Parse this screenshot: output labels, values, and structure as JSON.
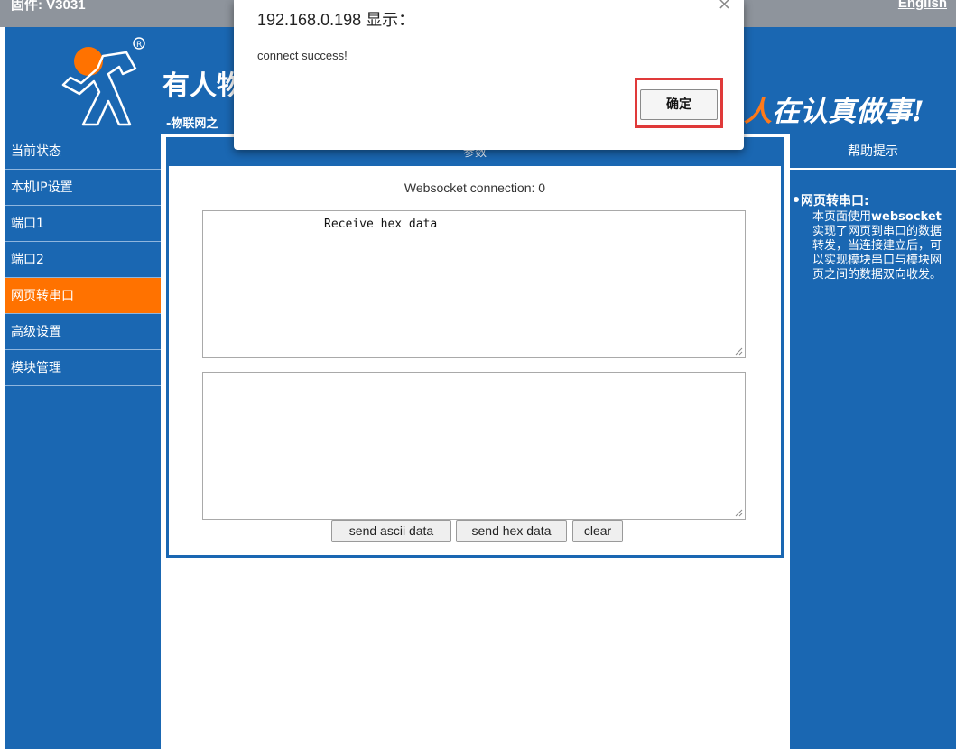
{
  "topbar": {
    "firmware": "固件: V3031",
    "language_link": "English"
  },
  "banner": {
    "company_name": "有人物",
    "company_sub": "-物联网之",
    "slogan_accent": "人",
    "slogan_rest": "在认真做事!"
  },
  "sidebar": {
    "items": [
      {
        "label": "当前状态"
      },
      {
        "label": "本机IP设置"
      },
      {
        "label": "端口1"
      },
      {
        "label": "端口2"
      },
      {
        "label": "网页转串口"
      },
      {
        "label": "高级设置"
      },
      {
        "label": "模块管理"
      }
    ],
    "active_index": 4
  },
  "main": {
    "header": "参数",
    "ws_status": "Websocket connection: 0",
    "receive_text": "Receive hex data",
    "send_text": "",
    "buttons": {
      "send_ascii": "send ascii data",
      "send_hex": "send hex data",
      "clear": "clear"
    }
  },
  "help": {
    "header": "帮助提示",
    "title": "网页转串口:",
    "text_before": "本页面使用",
    "text_bold": "websocket",
    "text_after": "实现了网页到串口的数据转发，当连接建立后，可以实现模块串口与模块网页之间的数据双向收发。"
  },
  "dialog": {
    "title": "192.168.0.198 显示：",
    "close_icon": "close-icon",
    "message": "connect success!",
    "ok_label": "确定"
  },
  "colors": {
    "primary_blue": "#1a67b2",
    "active_orange": "#ff7200",
    "highlight_red": "#e03a3a"
  }
}
